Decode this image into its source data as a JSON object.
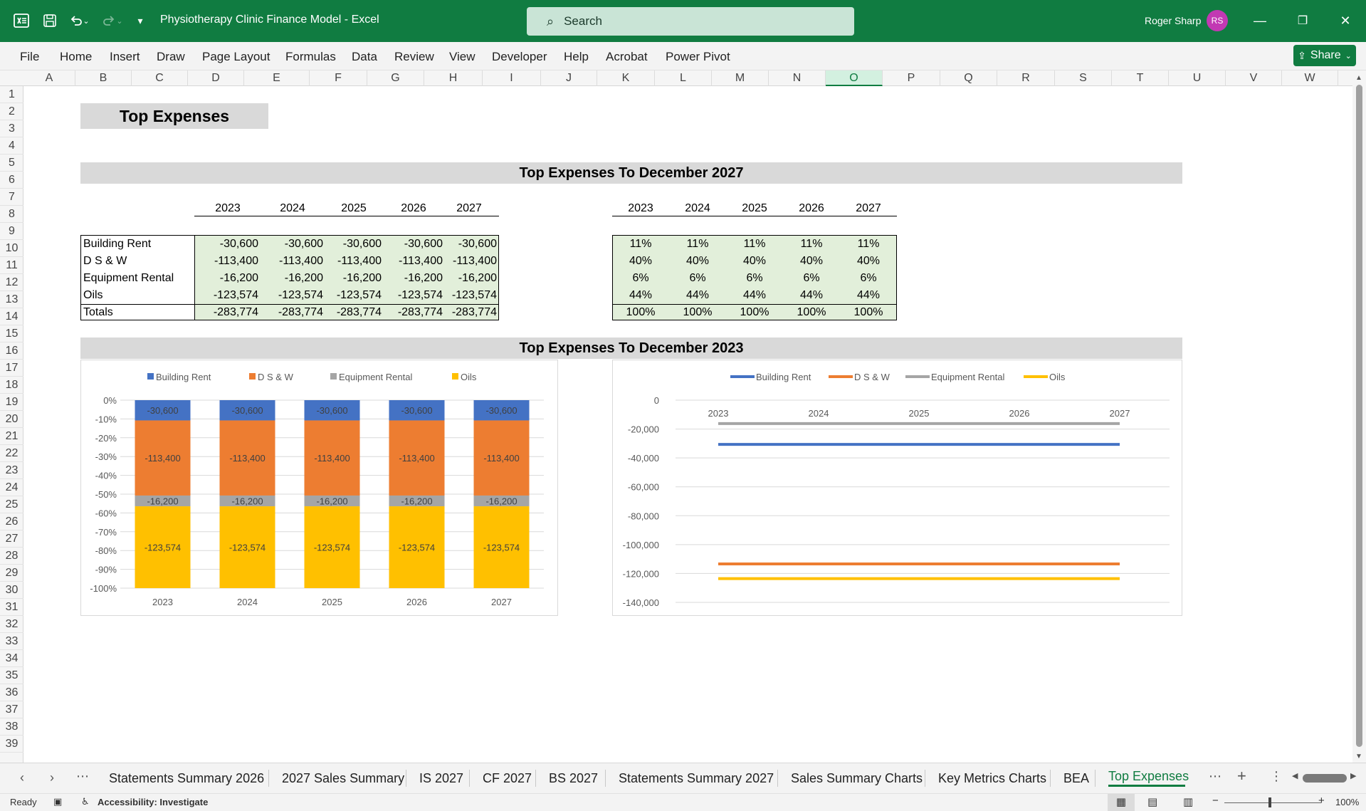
{
  "titlebar": {
    "title": "Physiotherapy Clinic Finance Model  -  Excel",
    "search_placeholder": "Search",
    "user_name": "Roger Sharp",
    "user_initials": "RS"
  },
  "menu": {
    "items": [
      "File",
      "Home",
      "Insert",
      "Draw",
      "Page Layout",
      "Formulas",
      "Data",
      "Review",
      "View",
      "Developer",
      "Help",
      "Acrobat",
      "Power Pivot"
    ],
    "share_label": "Share"
  },
  "columns": [
    "A",
    "B",
    "C",
    "D",
    "E",
    "F",
    "G",
    "H",
    "I",
    "J",
    "K",
    "L",
    "M",
    "N",
    "O",
    "P",
    "Q",
    "R",
    "S",
    "T",
    "U",
    "V",
    "W"
  ],
  "selected_column": "O",
  "rows": [
    "1",
    "2",
    "3",
    "4",
    "5",
    "6",
    "7",
    "8",
    "9",
    "10",
    "11",
    "12",
    "13",
    "14",
    "15",
    "16",
    "17",
    "18",
    "19",
    "20",
    "21",
    "22",
    "23",
    "24",
    "25",
    "26",
    "27",
    "28",
    "29",
    "30",
    "31",
    "32",
    "33",
    "34",
    "35",
    "36",
    "37",
    "38",
    "39"
  ],
  "sheet": {
    "title": "Top Expenses",
    "section1_title": "Top Expenses To December 2027",
    "section2_title": "Top Expenses To December 2023",
    "years": [
      "2023",
      "2024",
      "2025",
      "2026",
      "2027"
    ],
    "table_rows": [
      {
        "label": "Building Rent",
        "values": [
          "-30,600",
          "-30,600",
          "-30,600",
          "-30,600",
          "-30,600"
        ],
        "pcts": [
          "11%",
          "11%",
          "11%",
          "11%",
          "11%"
        ]
      },
      {
        "label": "D S & W",
        "values": [
          "-113,400",
          "-113,400",
          "-113,400",
          "-113,400",
          "-113,400"
        ],
        "pcts": [
          "40%",
          "40%",
          "40%",
          "40%",
          "40%"
        ]
      },
      {
        "label": "Equipment Rental",
        "values": [
          "-16,200",
          "-16,200",
          "-16,200",
          "-16,200",
          "-16,200"
        ],
        "pcts": [
          "6%",
          "6%",
          "6%",
          "6%",
          "6%"
        ]
      },
      {
        "label": "Oils",
        "values": [
          "-123,574",
          "-123,574",
          "-123,574",
          "-123,574",
          "-123,574"
        ],
        "pcts": [
          "44%",
          "44%",
          "44%",
          "44%",
          "44%"
        ]
      },
      {
        "label": "Totals",
        "values": [
          "-283,774",
          "-283,774",
          "-283,774",
          "-283,774",
          "-283,774"
        ],
        "pcts": [
          "100%",
          "100%",
          "100%",
          "100%",
          "100%"
        ]
      }
    ]
  },
  "chart_data": [
    {
      "type": "bar",
      "stacked": "percent",
      "categories": [
        "2023",
        "2024",
        "2025",
        "2026",
        "2027"
      ],
      "series": [
        {
          "name": "Building Rent",
          "color": "#4472c4",
          "values": [
            -30600,
            -30600,
            -30600,
            -30600,
            -30600
          ],
          "labels": [
            "-30,600",
            "-30,600",
            "-30,600",
            "-30,600",
            "-30,600"
          ]
        },
        {
          "name": "D S & W",
          "color": "#ed7d31",
          "values": [
            -113400,
            -113400,
            -113400,
            -113400,
            -113400
          ],
          "labels": [
            "-113,400",
            "-113,400",
            "-113,400",
            "-113,400",
            "-113,400"
          ]
        },
        {
          "name": "Equipment Rental",
          "color": "#a5a5a5",
          "values": [
            -16200,
            -16200,
            -16200,
            -16200,
            -16200
          ],
          "labels": [
            "-16,200",
            "-16,200",
            "-16,200",
            "-16,200",
            "-16,200"
          ]
        },
        {
          "name": "Oils",
          "color": "#ffc000",
          "values": [
            -123574,
            -123574,
            -123574,
            -123574,
            -123574
          ],
          "labels": [
            "-123,574",
            "-123,574",
            "-123,574",
            "-123,574",
            "-123,574"
          ]
        }
      ],
      "y_ticks": [
        "0%",
        "-10%",
        "-20%",
        "-30%",
        "-40%",
        "-50%",
        "-60%",
        "-70%",
        "-80%",
        "-90%",
        "-100%"
      ],
      "ylim": [
        -100,
        0
      ],
      "legend": "top",
      "grid": true
    },
    {
      "type": "line",
      "x": [
        "2023",
        "2024",
        "2025",
        "2026",
        "2027"
      ],
      "series": [
        {
          "name": "Building Rent",
          "color": "#4472c4",
          "values": [
            -30600,
            -30600,
            -30600,
            -30600,
            -30600
          ]
        },
        {
          "name": "D S & W",
          "color": "#ed7d31",
          "values": [
            -113400,
            -113400,
            -113400,
            -113400,
            -113400
          ]
        },
        {
          "name": "Equipment Rental",
          "color": "#a5a5a5",
          "values": [
            -16200,
            -16200,
            -16200,
            -16200,
            -16200
          ]
        },
        {
          "name": "Oils",
          "color": "#ffc000",
          "values": [
            -123574,
            -123574,
            -123574,
            -123574,
            -123574
          ]
        }
      ],
      "y_ticks": [
        "0",
        "-20,000",
        "-40,000",
        "-60,000",
        "-80,000",
        "-100,000",
        "-120,000",
        "-140,000"
      ],
      "ylim": [
        -140000,
        0
      ],
      "legend": "top",
      "grid": true
    }
  ],
  "tabs": [
    "Statements Summary 2026",
    "2027 Sales Summary",
    "IS 2027",
    "CF 2027",
    "BS 2027",
    "Statements Summary 2027",
    "Sales Summary Charts",
    "Key Metrics Charts",
    "BEA",
    "Top Expenses"
  ],
  "active_tab": "Top Expenses",
  "status": {
    "ready": "Ready",
    "accessibility": "Accessibility: Investigate",
    "zoom": "100%"
  }
}
